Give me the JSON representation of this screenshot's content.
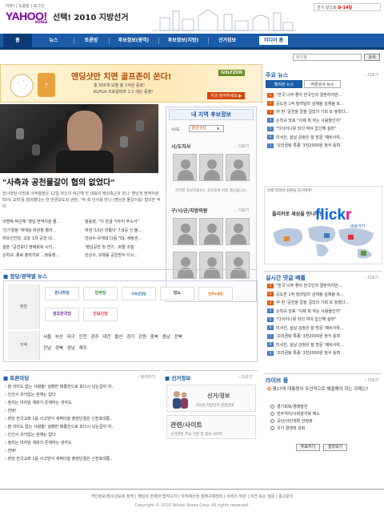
{
  "header": {
    "top_links": "야후! | 도움말 | 로그인",
    "logo": "YAHOO!",
    "logo_sub": "KOREA",
    "site_title": "선택! 2010 지방선거",
    "dday_label": "선거 앞으로",
    "dday_value": "D-14일"
  },
  "nav": {
    "items": [
      "홈",
      "뉴스",
      "토론방",
      "후보정보(광역)",
      "후보정보(지방)",
      "선거정보"
    ],
    "media": "미디어 홈"
  },
  "search": {
    "placeholder": "정인봉",
    "button": "검색"
  },
  "banner": {
    "headline": "엔딩샷만 치면 골프존이 쏜다!",
    "line1": "총 500개 모델 총 1억원 증정!",
    "line2": "KLPGA 프로골퍼와 1:1 레슨 증정!",
    "brand": "GOLFZON",
    "cta": "지금 참여하세요 ▶"
  },
  "main_story": {
    "headline": "\"사측과 공천물갈이 협의 없었다\"",
    "summary": "한나라당 이방호 사무총장은 12일 자신의 박근혜 전 대표의 핵심측근과 만나 '영남권 현역의원 50% 교체'를 협의했다는 한 언론보도와 관련, \"박 측 인사를 만나 (영남권 물갈이를) 협의한 적이"
  },
  "news_left": [
    "이명박-박근혜 '영남 현역의원 물...",
    "'인기절정' 박재승 위원장 출마...",
    "자유선진당, 오늘 1차 공천 내...",
    "설훈 \"공천보다 명예회복 시키...",
    "손학규, 종로 출마키로 ...정동영..."
  ],
  "news_right": [
    "정동영, \"이 한글 거두어 주소서\"",
    "여권 '10년 전통이' 7:8공 신 볼...",
    "안상수-유재대 다음 \"DJ, 새정권...",
    "'영남공천 첫 연기...파열 조짐",
    "안상수, 모택동 공천방식 다시..."
  ],
  "candidate": {
    "title": "내 지역 후보정보",
    "select_label": "시/도",
    "select_value": "경남구감",
    "sido_label": "시/도지사",
    "gusigun_label": "구/시/군/지방의원",
    "more": "› 더보기",
    "note": "지역별 후보자정보는 후보등록 이후 제공됩니다."
  },
  "issues": {
    "title": "주요 뉴스",
    "tabs": [
      "헬리본 뉴스",
      "여론조사 뉴스"
    ],
    "more": "› 더보기",
    "items": [
      "\"한국 너무 좋아 한국인과 결혼하지만...",
      "공도한 1억 빌려달라 김재율 김재율 트...",
      "中 판 '공천을 칼을 걸었의 기회 또 놓쳤다...",
      "손학규 당표 \"이제 뭐 하는 사람들인지\"",
      "\"다이어니뮤 되다 여야 없신해 설마\"",
      "미서진, 설날 김정은 잘 방문 '예비사위...",
      "'꼬리곰탕 특종' 3천2000원 정식 틀며"
    ]
  },
  "ad": {
    "top": "야후!코리아 회원님 친구에게!",
    "sub": "플리커로 세상을 만나다!",
    "brand_flick": "flick",
    "brand_r": "r",
    "link": "바로가기"
  },
  "realtime": {
    "title": "실시간 댓글 베틀",
    "more": "› 더보기",
    "items": [
      "\"한국 너무 좋아 한국인과 결혼하지만...",
      "공도한 1억 빌려달라 김재율 김재율 트...",
      "中 판 '공천을 칼을 걸었의 기회 또 놓쳤다...",
      "손학규 당표 \"이제 뭐 하는 사람들인지\"",
      "\"다이어니뮤 되다 여야 없신해 설마\"",
      "미서진, 설날 김정은 잘 방문 '예비사위...",
      "'꼬리곰탕 특종' 3천2000원 정식 틀며",
      "미서진, 설날 김정은 잘 방문 '예비사위...",
      "'꼬리곰탕 특종' 3천2000원 정식 틀며"
    ]
  },
  "parties": {
    "title": "정당/광역별 뉴스",
    "party_label": "정당",
    "region_label": "지역",
    "logos": [
      "한나라당",
      "민주당",
      "자유선진당",
      "민노",
      "민주노동당",
      "창조한국당",
      "진보신당"
    ],
    "regions_row1": [
      "서울",
      "부산",
      "대구",
      "인천",
      "광주",
      "대전",
      "울산",
      "경기",
      "강원",
      "충북",
      "충남",
      "전북"
    ],
    "regions_row2": [
      "전남",
      "경북",
      "경남",
      "제주"
    ]
  },
  "debate": {
    "title": "토론마당",
    "more": "› 참여하기",
    "items": [
      "참 의미도 없는 사람들! 실패한 매룡한으로 또다시 남는걸까 차..",
      "인간사 과거없는 현재는 없다",
      "정치는 여자임 계파가 존재하는 생각도",
      "찬바!",
      "창당 한국교회 1등 사고방식 새벽이을 출판단결은 신전호대통..",
      "참 의미도 없는 사람들! 실패한 매룡한으로 또다시 남는걸까 차..",
      "인간사 과거없는 현재는 없다",
      "정치는 여자임 계파가 존재하는 생각도",
      "찬바!",
      "창당 한국교회 1등 사고방식 새벽이을 출판단결은 신전호대통.."
    ]
  },
  "election_info": {
    "title": "선거정보",
    "more": "› 더보기",
    "card1_title": "선거/정보",
    "card1_sub": "2010 지방선거 일정안내",
    "card2_title": "관련/사이트",
    "card2_sub": "선거관련 주요 기관 및 정보 사이트"
  },
  "poll": {
    "title": "라이브 폴",
    "more": "› 더보기",
    "question": "제17대 대통령이 우선적으로 해결해야 하는 과제는?",
    "options": [
      "경기회복/경제발전",
      "빈부격차/사회양극화 해소",
      "공산/사민생활 안정화",
      "국가 경쟁력 강화"
    ],
    "vote": "투표하기",
    "result": "결과보기"
  },
  "footer": {
    "links": "개인정보/청소년보호 정책  |  책임의 한계와 법적고지  |  지적재산권 침해구제센터  |  서비스 약관  |  의견 또는 질문  |  광고문의",
    "copyright": "Copyright © 2010 Yahoo! Korea Corp. All rights reserved."
  }
}
